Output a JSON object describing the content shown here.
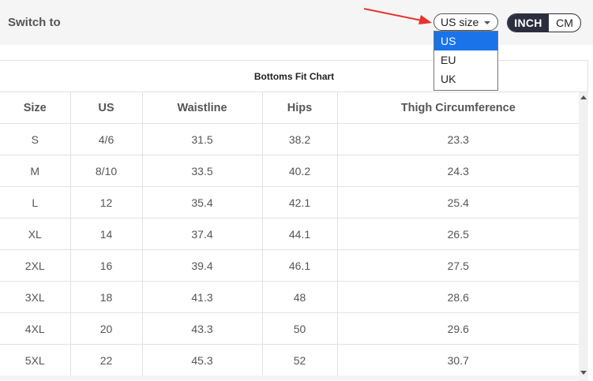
{
  "header": {
    "switch_label": "Switch to",
    "size_select_value": "US size",
    "size_options": [
      "US",
      "EU",
      "UK"
    ],
    "selected_option": "US",
    "units": [
      "INCH",
      "CM"
    ],
    "active_unit": "INCH"
  },
  "colors": {
    "accent_dark": "#2c2e3f",
    "selected_option_bg": "#1a73e8",
    "annotation_arrow": "#e8322b"
  },
  "table": {
    "title": "Bottoms Fit Chart",
    "columns": [
      "Size",
      "US",
      "Waistline",
      "Hips",
      "Thigh Circumference"
    ],
    "rows": [
      [
        "S",
        "4/6",
        "31.5",
        "38.2",
        "23.3"
      ],
      [
        "M",
        "8/10",
        "33.5",
        "40.2",
        "24.3"
      ],
      [
        "L",
        "12",
        "35.4",
        "42.1",
        "25.4"
      ],
      [
        "XL",
        "14",
        "37.4",
        "44.1",
        "26.5"
      ],
      [
        "2XL",
        "16",
        "39.4",
        "46.1",
        "27.5"
      ],
      [
        "3XL",
        "18",
        "41.3",
        "48",
        "28.6"
      ],
      [
        "4XL",
        "20",
        "43.3",
        "50",
        "29.6"
      ],
      [
        "5XL",
        "22",
        "45.3",
        "52",
        "30.7"
      ]
    ]
  }
}
